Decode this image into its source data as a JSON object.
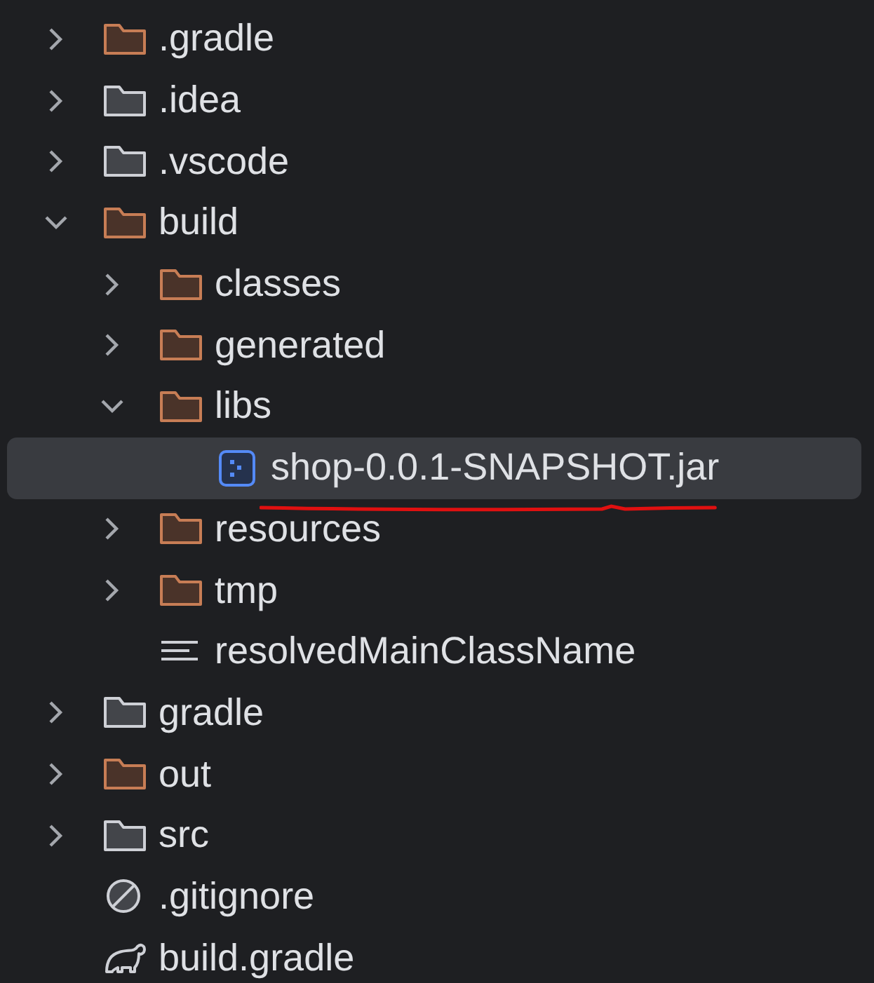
{
  "tree": [
    {
      "label": ".gradle",
      "kind": "output-folder",
      "expanded": false,
      "selected": false
    },
    {
      "label": ".idea",
      "kind": "folder",
      "expanded": false,
      "selected": false
    },
    {
      "label": ".vscode",
      "kind": "folder",
      "expanded": false,
      "selected": false
    },
    {
      "label": "build",
      "kind": "output-folder",
      "expanded": true,
      "selected": false,
      "children": [
        {
          "label": "classes",
          "kind": "output-folder",
          "expanded": false,
          "selected": false
        },
        {
          "label": "generated",
          "kind": "output-folder",
          "expanded": false,
          "selected": false
        },
        {
          "label": "libs",
          "kind": "output-folder",
          "expanded": true,
          "selected": false,
          "children": [
            {
              "label": "shop-0.0.1-SNAPSHOT.jar",
              "kind": "jar",
              "selected": true
            }
          ]
        },
        {
          "label": "resources",
          "kind": "output-folder",
          "expanded": false,
          "selected": false
        },
        {
          "label": "tmp",
          "kind": "output-folder",
          "expanded": false,
          "selected": false
        },
        {
          "label": "resolvedMainClassName",
          "kind": "text-file",
          "selected": false
        }
      ]
    },
    {
      "label": "gradle",
      "kind": "folder",
      "expanded": false,
      "selected": false
    },
    {
      "label": "out",
      "kind": "output-folder",
      "expanded": false,
      "selected": false
    },
    {
      "label": "src",
      "kind": "folder",
      "expanded": false,
      "selected": false
    },
    {
      "label": ".gitignore",
      "kind": "ignore-file",
      "selected": false
    },
    {
      "label": "build.gradle",
      "kind": "gradle-file",
      "selected": false
    }
  ]
}
